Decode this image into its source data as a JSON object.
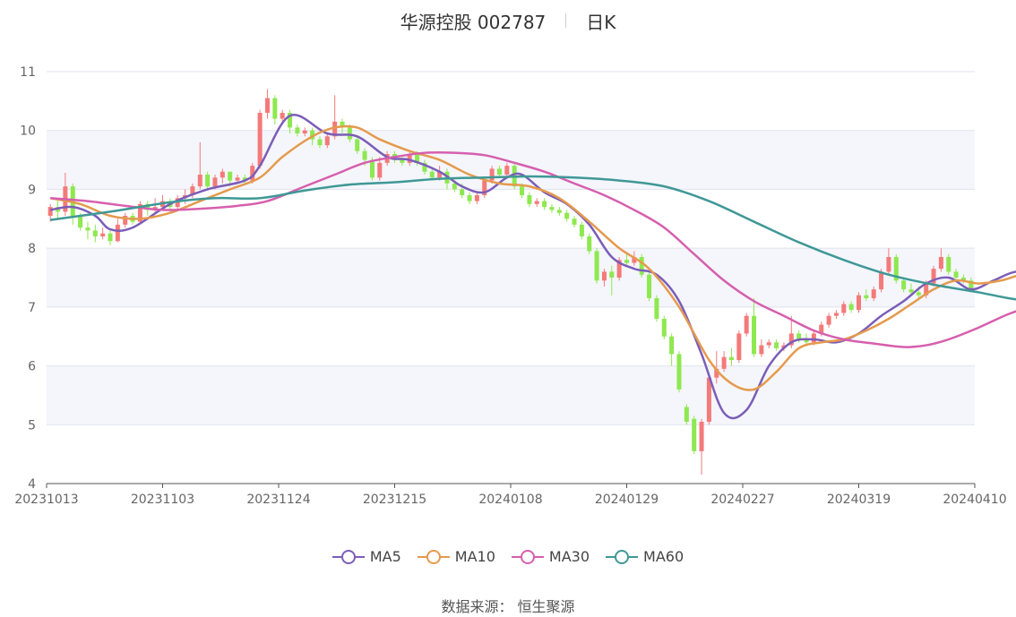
{
  "title": {
    "name": "华源控股 002787",
    "period": "日K"
  },
  "source_text": "数据来源： 恒生聚源",
  "colors": {
    "up": "#f47a7a",
    "down": "#8ee84f",
    "MA5": "#7b5db8",
    "MA10": "#e59a4e",
    "MA30": "#d65fae",
    "MA60": "#3f9896",
    "grid": "#dfe3ee",
    "band": "#f4f6fb"
  },
  "chart_data": {
    "type": "candlestick",
    "ylim": [
      4,
      11
    ],
    "yticks": [
      "4",
      "5",
      "6",
      "7",
      "8",
      "9",
      "10",
      "11"
    ],
    "xticks": [
      "20231013",
      "20231103",
      "20231124",
      "20231215",
      "20240108",
      "20240129",
      "20240227",
      "20240319",
      "20240410"
    ],
    "grid": true,
    "legend_position": "bottom",
    "candles_ohlc": [
      [
        8.55,
        8.7,
        8.45,
        8.75
      ],
      [
        8.7,
        8.62,
        8.5,
        8.85
      ],
      [
        8.62,
        9.05,
        8.55,
        9.28
      ],
      [
        9.05,
        8.55,
        8.4,
        9.1
      ],
      [
        8.55,
        8.35,
        8.3,
        8.6
      ],
      [
        8.35,
        8.3,
        8.15,
        8.45
      ],
      [
        8.3,
        8.2,
        8.1,
        8.4
      ],
      [
        8.2,
        8.25,
        8.15,
        8.35
      ],
      [
        8.25,
        8.12,
        8.05,
        8.3
      ],
      [
        8.12,
        8.4,
        8.1,
        8.5
      ],
      [
        8.4,
        8.55,
        8.35,
        8.6
      ],
      [
        8.55,
        8.45,
        8.4,
        8.6
      ],
      [
        8.45,
        8.75,
        8.4,
        8.8
      ],
      [
        8.75,
        8.65,
        8.55,
        8.8
      ],
      [
        8.65,
        8.7,
        8.6,
        8.85
      ],
      [
        8.7,
        8.8,
        8.65,
        8.9
      ],
      [
        8.8,
        8.7,
        8.6,
        8.85
      ],
      [
        8.7,
        8.85,
        8.65,
        8.9
      ],
      [
        8.85,
        8.9,
        8.75,
        9.0
      ],
      [
        8.9,
        9.05,
        8.85,
        9.1
      ],
      [
        9.05,
        9.25,
        9.0,
        9.8
      ],
      [
        9.25,
        9.05,
        9.0,
        9.3
      ],
      [
        9.05,
        9.2,
        9.0,
        9.25
      ],
      [
        9.2,
        9.3,
        9.1,
        9.35
      ],
      [
        9.3,
        9.15,
        9.05,
        9.3
      ],
      [
        9.15,
        9.2,
        9.1,
        9.25
      ],
      [
        9.2,
        9.15,
        9.1,
        9.25
      ],
      [
        9.15,
        9.4,
        9.1,
        9.45
      ],
      [
        9.4,
        10.3,
        9.35,
        10.35
      ],
      [
        10.3,
        10.55,
        10.2,
        10.7
      ],
      [
        10.55,
        10.2,
        10.1,
        10.6
      ],
      [
        10.2,
        10.3,
        10.15,
        10.35
      ],
      [
        10.3,
        10.05,
        9.95,
        10.35
      ],
      [
        10.05,
        9.95,
        9.9,
        10.1
      ],
      [
        9.95,
        10.0,
        9.9,
        10.05
      ],
      [
        10.0,
        9.85,
        9.75,
        10.05
      ],
      [
        9.85,
        9.75,
        9.7,
        9.9
      ],
      [
        9.75,
        9.9,
        9.7,
        9.95
      ],
      [
        9.9,
        10.15,
        9.85,
        10.6
      ],
      [
        10.15,
        10.05,
        9.95,
        10.2
      ],
      [
        10.05,
        9.85,
        9.8,
        10.1
      ],
      [
        9.85,
        9.65,
        9.6,
        9.9
      ],
      [
        9.65,
        9.5,
        9.4,
        9.7
      ],
      [
        9.5,
        9.2,
        9.15,
        9.55
      ],
      [
        9.2,
        9.45,
        9.15,
        9.55
      ],
      [
        9.45,
        9.6,
        9.4,
        9.65
      ],
      [
        9.6,
        9.5,
        9.45,
        9.65
      ],
      [
        9.5,
        9.45,
        9.4,
        9.55
      ],
      [
        9.45,
        9.6,
        9.4,
        9.65
      ],
      [
        9.6,
        9.45,
        9.4,
        9.65
      ],
      [
        9.45,
        9.3,
        9.25,
        9.5
      ],
      [
        9.3,
        9.2,
        9.15,
        9.35
      ],
      [
        9.2,
        9.3,
        9.15,
        9.4
      ],
      [
        9.3,
        9.1,
        9.0,
        9.35
      ],
      [
        9.1,
        9.0,
        8.95,
        9.15
      ],
      [
        9.0,
        8.9,
        8.85,
        9.1
      ],
      [
        8.9,
        8.8,
        8.75,
        8.95
      ],
      [
        8.8,
        8.9,
        8.75,
        8.95
      ],
      [
        8.9,
        9.15,
        8.85,
        9.2
      ],
      [
        9.15,
        9.35,
        9.1,
        9.4
      ],
      [
        9.35,
        9.25,
        9.2,
        9.4
      ],
      [
        9.25,
        9.4,
        9.2,
        9.45
      ],
      [
        9.4,
        9.05,
        9.0,
        9.45
      ],
      [
        9.05,
        8.9,
        8.85,
        9.1
      ],
      [
        8.9,
        8.75,
        8.7,
        8.95
      ],
      [
        8.75,
        8.8,
        8.7,
        8.85
      ],
      [
        8.8,
        8.7,
        8.65,
        8.85
      ],
      [
        8.7,
        8.65,
        8.6,
        8.75
      ],
      [
        8.65,
        8.6,
        8.55,
        8.7
      ],
      [
        8.6,
        8.5,
        8.45,
        8.65
      ],
      [
        8.5,
        8.4,
        8.35,
        8.55
      ],
      [
        8.4,
        8.2,
        8.15,
        8.45
      ],
      [
        8.2,
        7.95,
        7.9,
        8.25
      ],
      [
        7.95,
        7.45,
        7.4,
        8.0
      ],
      [
        7.45,
        7.6,
        7.35,
        7.65
      ],
      [
        7.6,
        7.5,
        7.2,
        7.7
      ],
      [
        7.5,
        7.8,
        7.45,
        7.85
      ],
      [
        7.8,
        7.75,
        7.7,
        7.9
      ],
      [
        7.75,
        7.85,
        7.7,
        7.95
      ],
      [
        7.85,
        7.55,
        7.5,
        7.9
      ],
      [
        7.55,
        7.15,
        7.1,
        7.6
      ],
      [
        7.15,
        6.8,
        6.75,
        7.2
      ],
      [
        6.8,
        6.5,
        6.45,
        6.85
      ],
      [
        6.5,
        6.2,
        6.0,
        6.55
      ],
      [
        6.2,
        5.6,
        5.55,
        6.25
      ],
      [
        5.3,
        5.05,
        5.0,
        5.35
      ],
      [
        5.1,
        4.55,
        4.5,
        5.15
      ],
      [
        4.55,
        5.05,
        4.15,
        5.1
      ],
      [
        5.05,
        5.8,
        5.0,
        5.85
      ],
      [
        5.8,
        5.95,
        5.7,
        6.25
      ],
      [
        5.95,
        6.15,
        5.9,
        6.25
      ],
      [
        6.15,
        6.1,
        6.0,
        6.3
      ],
      [
        6.1,
        6.55,
        6.05,
        6.6
      ],
      [
        6.55,
        6.85,
        6.5,
        6.9
      ],
      [
        6.85,
        6.2,
        6.15,
        7.15
      ],
      [
        6.2,
        6.35,
        6.15,
        6.45
      ],
      [
        6.35,
        6.4,
        6.3,
        6.45
      ],
      [
        6.4,
        6.3,
        6.25,
        6.45
      ],
      [
        6.3,
        6.35,
        6.25,
        6.4
      ],
      [
        6.35,
        6.55,
        6.3,
        6.85
      ],
      [
        6.55,
        6.45,
        6.4,
        6.6
      ],
      [
        6.45,
        6.4,
        6.35,
        6.55
      ],
      [
        6.4,
        6.55,
        6.35,
        6.6
      ],
      [
        6.55,
        6.7,
        6.5,
        6.75
      ],
      [
        6.7,
        6.85,
        6.65,
        6.9
      ],
      [
        6.85,
        6.9,
        6.8,
        6.95
      ],
      [
        6.9,
        7.05,
        6.85,
        7.1
      ],
      [
        7.05,
        6.95,
        6.9,
        7.1
      ],
      [
        6.95,
        7.2,
        6.9,
        7.25
      ],
      [
        7.2,
        7.15,
        7.1,
        7.3
      ],
      [
        7.15,
        7.3,
        7.1,
        7.35
      ],
      [
        7.3,
        7.6,
        7.25,
        7.65
      ],
      [
        7.6,
        7.85,
        7.55,
        8.0
      ],
      [
        7.85,
        7.45,
        7.4,
        7.9
      ],
      [
        7.45,
        7.3,
        7.25,
        7.5
      ],
      [
        7.3,
        7.25,
        7.2,
        7.4
      ],
      [
        7.25,
        7.2,
        7.15,
        7.35
      ],
      [
        7.2,
        7.4,
        7.15,
        7.45
      ],
      [
        7.4,
        7.65,
        7.35,
        7.7
      ],
      [
        7.65,
        7.85,
        7.6,
        8.0
      ],
      [
        7.85,
        7.6,
        7.55,
        7.9
      ],
      [
        7.6,
        7.5,
        7.45,
        7.65
      ],
      [
        7.5,
        7.45,
        7.4,
        7.55
      ],
      [
        7.45,
        7.3,
        7.25,
        7.5
      ]
    ],
    "series": [
      {
        "name": "MA5",
        "points": [
          [
            0,
            8.65
          ],
          [
            3,
            8.7
          ],
          [
            6,
            8.55
          ],
          [
            8,
            8.32
          ],
          [
            11,
            8.35
          ],
          [
            16,
            8.75
          ],
          [
            21,
            9.0
          ],
          [
            26,
            9.15
          ],
          [
            28,
            9.4
          ],
          [
            32,
            10.25
          ],
          [
            37,
            9.95
          ],
          [
            41,
            9.9
          ],
          [
            45,
            9.55
          ],
          [
            48,
            9.5
          ],
          [
            52,
            9.3
          ],
          [
            55,
            9.05
          ],
          [
            58,
            8.95
          ],
          [
            61,
            9.2
          ],
          [
            63,
            9.25
          ],
          [
            66,
            8.95
          ],
          [
            69,
            8.75
          ],
          [
            72,
            8.4
          ],
          [
            75,
            7.85
          ],
          [
            78,
            7.65
          ],
          [
            81,
            7.55
          ],
          [
            84,
            7.1
          ],
          [
            87,
            6.2
          ],
          [
            90,
            5.2
          ],
          [
            93,
            5.25
          ],
          [
            96,
            6.0
          ],
          [
            99,
            6.4
          ],
          [
            102,
            6.45
          ],
          [
            105,
            6.4
          ],
          [
            108,
            6.55
          ],
          [
            111,
            6.85
          ],
          [
            114,
            7.1
          ],
          [
            117,
            7.4
          ],
          [
            120,
            7.5
          ],
          [
            123,
            7.3
          ],
          [
            126,
            7.45
          ],
          [
            129,
            7.6
          ],
          [
            132,
            7.55
          ]
        ]
      },
      {
        "name": "MA10",
        "points": [
          [
            0,
            8.85
          ],
          [
            4,
            8.75
          ],
          [
            8,
            8.55
          ],
          [
            12,
            8.5
          ],
          [
            16,
            8.6
          ],
          [
            20,
            8.8
          ],
          [
            24,
            9.0
          ],
          [
            28,
            9.2
          ],
          [
            31,
            9.55
          ],
          [
            35,
            9.9
          ],
          [
            38,
            10.05
          ],
          [
            41,
            10.05
          ],
          [
            44,
            9.85
          ],
          [
            48,
            9.65
          ],
          [
            52,
            9.5
          ],
          [
            56,
            9.25
          ],
          [
            60,
            9.1
          ],
          [
            64,
            9.05
          ],
          [
            68,
            8.85
          ],
          [
            72,
            8.45
          ],
          [
            76,
            8.0
          ],
          [
            80,
            7.65
          ],
          [
            84,
            7.0
          ],
          [
            88,
            6.1
          ],
          [
            91,
            5.7
          ],
          [
            94,
            5.6
          ],
          [
            97,
            5.9
          ],
          [
            100,
            6.3
          ],
          [
            103,
            6.4
          ],
          [
            106,
            6.45
          ],
          [
            109,
            6.6
          ],
          [
            112,
            6.8
          ],
          [
            115,
            7.05
          ],
          [
            118,
            7.3
          ],
          [
            121,
            7.45
          ],
          [
            124,
            7.4
          ],
          [
            127,
            7.45
          ],
          [
            130,
            7.55
          ],
          [
            132,
            7.45
          ]
        ]
      },
      {
        "name": "MA30",
        "points": [
          [
            0,
            8.85
          ],
          [
            5,
            8.8
          ],
          [
            10,
            8.72
          ],
          [
            15,
            8.65
          ],
          [
            20,
            8.67
          ],
          [
            25,
            8.72
          ],
          [
            29,
            8.8
          ],
          [
            34,
            9.05
          ],
          [
            38,
            9.25
          ],
          [
            42,
            9.45
          ],
          [
            46,
            9.55
          ],
          [
            50,
            9.62
          ],
          [
            54,
            9.62
          ],
          [
            58,
            9.58
          ],
          [
            62,
            9.45
          ],
          [
            66,
            9.3
          ],
          [
            70,
            9.1
          ],
          [
            74,
            8.9
          ],
          [
            78,
            8.65
          ],
          [
            82,
            8.35
          ],
          [
            86,
            7.9
          ],
          [
            90,
            7.45
          ],
          [
            94,
            7.1
          ],
          [
            98,
            6.85
          ],
          [
            102,
            6.6
          ],
          [
            106,
            6.45
          ],
          [
            110,
            6.38
          ],
          [
            114,
            6.32
          ],
          [
            117,
            6.35
          ],
          [
            120,
            6.45
          ],
          [
            124,
            6.65
          ],
          [
            128,
            6.88
          ],
          [
            132,
            7.05
          ]
        ]
      },
      {
        "name": "MA60",
        "points": [
          [
            0,
            8.48
          ],
          [
            8,
            8.62
          ],
          [
            16,
            8.78
          ],
          [
            22,
            8.85
          ],
          [
            28,
            8.85
          ],
          [
            34,
            8.98
          ],
          [
            40,
            9.08
          ],
          [
            46,
            9.12
          ],
          [
            52,
            9.18
          ],
          [
            58,
            9.2
          ],
          [
            64,
            9.22
          ],
          [
            70,
            9.2
          ],
          [
            76,
            9.15
          ],
          [
            82,
            9.05
          ],
          [
            88,
            8.8
          ],
          [
            94,
            8.45
          ],
          [
            100,
            8.1
          ],
          [
            106,
            7.8
          ],
          [
            112,
            7.55
          ],
          [
            118,
            7.38
          ],
          [
            124,
            7.25
          ],
          [
            128,
            7.15
          ],
          [
            132,
            7.08
          ]
        ]
      }
    ]
  },
  "legend": [
    {
      "label": "MA5",
      "color": "#7b5db8"
    },
    {
      "label": "MA10",
      "color": "#e59a4e"
    },
    {
      "label": "MA30",
      "color": "#d65fae"
    },
    {
      "label": "MA60",
      "color": "#3f9896"
    }
  ]
}
